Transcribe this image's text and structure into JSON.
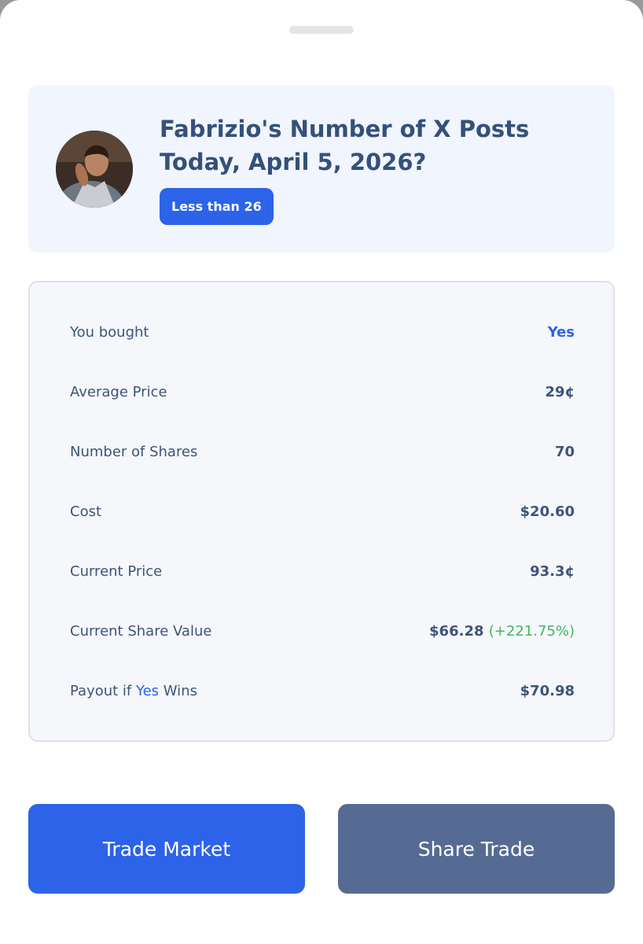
{
  "market": {
    "title": "Fabrizio's Number of X Posts Today, April 5, 2026?",
    "outcome_badge": "Less than 26"
  },
  "details": {
    "you_bought": {
      "label": "You bought",
      "value": "Yes"
    },
    "average_price": {
      "label": "Average Price",
      "value": "29¢"
    },
    "number_of_shares": {
      "label": "Number of Shares",
      "value": "70"
    },
    "cost": {
      "label": "Cost",
      "value": "$20.60"
    },
    "current_price": {
      "label": "Current Price",
      "value": "93.3¢"
    },
    "current_share_value": {
      "label": "Current Share Value",
      "value": "$66.28",
      "change": "(+221.75%)"
    },
    "payout": {
      "label_prefix": "Payout if ",
      "label_outcome": "Yes",
      "label_suffix": " Wins",
      "value": "$70.98"
    }
  },
  "actions": {
    "trade_label": "Trade Market",
    "share_label": "Share Trade"
  },
  "colors": {
    "primary_blue": "#2c63e8",
    "slate_button": "#566b93",
    "text_navy": "#35507a",
    "gain_green": "#44b562",
    "card_tint": "#f0f5fe"
  },
  "icons": {
    "avatar": "profile-photo"
  }
}
